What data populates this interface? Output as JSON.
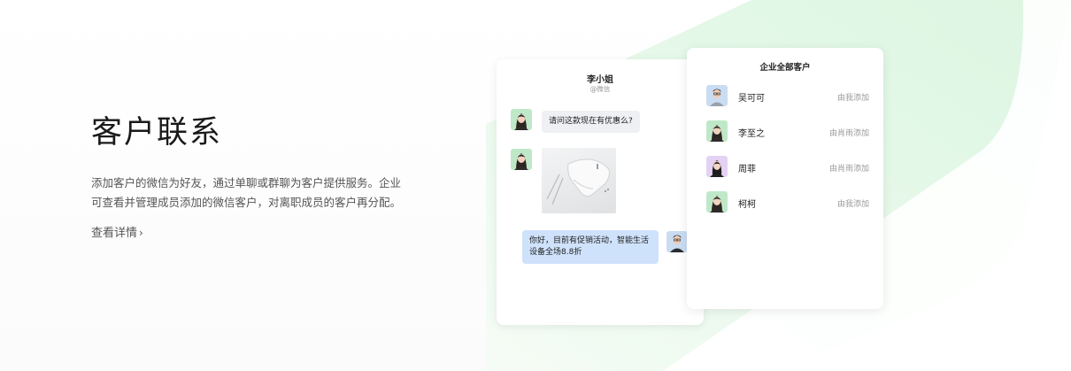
{
  "intro": {
    "title": "客户联系",
    "description": "添加客户的微信为好友，通过单聊或群聊为客户提供服务。企业可查看并管理成员添加的微信客户，对离职成员的客户再分配。",
    "link_label": "查看详情",
    "link_chevron": "›"
  },
  "chat": {
    "contact_name": "李小姐",
    "contact_source": "@微信",
    "message_in": "请问这款现在有优惠么?",
    "message_out": "你好，目前有促销活动，智能生活设备全场8.8折"
  },
  "customers": {
    "title": "企业全部客户",
    "items": [
      {
        "name": "吴可可",
        "source": "由我添加",
        "avatar_bg": "#c9dcf2"
      },
      {
        "name": "李至之",
        "source": "由肖雨添加",
        "avatar_bg": "#bfe8c9"
      },
      {
        "name": "周菲",
        "source": "由肖雨添加",
        "avatar_bg": "#e3d2f3"
      },
      {
        "name": "柯柯",
        "source": "由我添加",
        "avatar_bg": "#bfe8c9"
      }
    ]
  },
  "colors": {
    "accent_green": "#d9f6df",
    "bubble_out": "#cfe2fb",
    "bubble_in": "#eef0f3"
  }
}
